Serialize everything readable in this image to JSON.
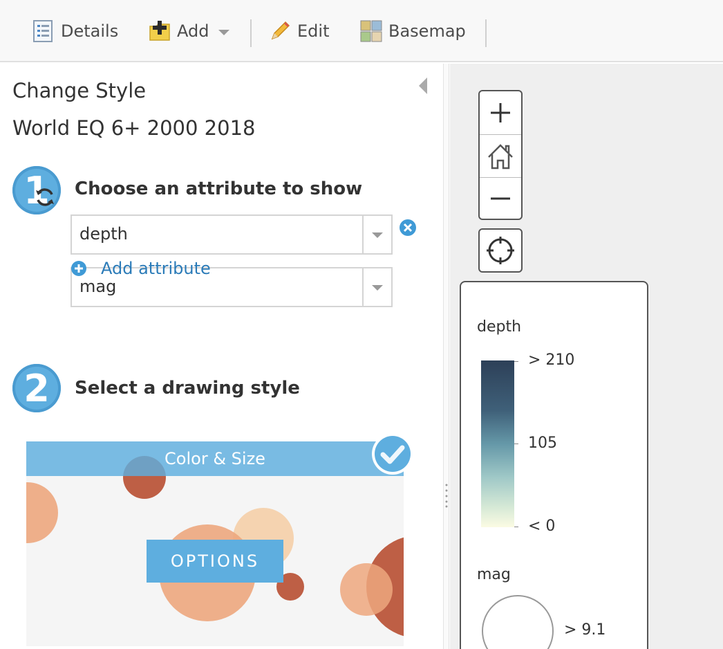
{
  "toolbar": {
    "details": "Details",
    "add": "Add",
    "edit": "Edit",
    "basemap": "Basemap"
  },
  "panel": {
    "title": "Change Style",
    "layer_name": "World EQ 6+ 2000 2018",
    "step1": {
      "number": "1",
      "title": "Choose an attribute to show",
      "attributes": [
        "depth",
        "mag"
      ],
      "add_attribute": "Add attribute"
    },
    "step2": {
      "number": "2",
      "title": "Select a drawing style",
      "style_name": "Color & Size",
      "options": "OPTIONS"
    }
  },
  "legend": {
    "depth": {
      "title": "depth",
      "high": "> 210",
      "mid": "105",
      "low": "< 0"
    },
    "mag": {
      "title": "mag",
      "high": "> 9.1"
    }
  },
  "colors": {
    "accent": "#5eaedf",
    "link": "#2b7bb8",
    "ramp_high": "#2d4058",
    "ramp_low": "#fbfbe3"
  }
}
